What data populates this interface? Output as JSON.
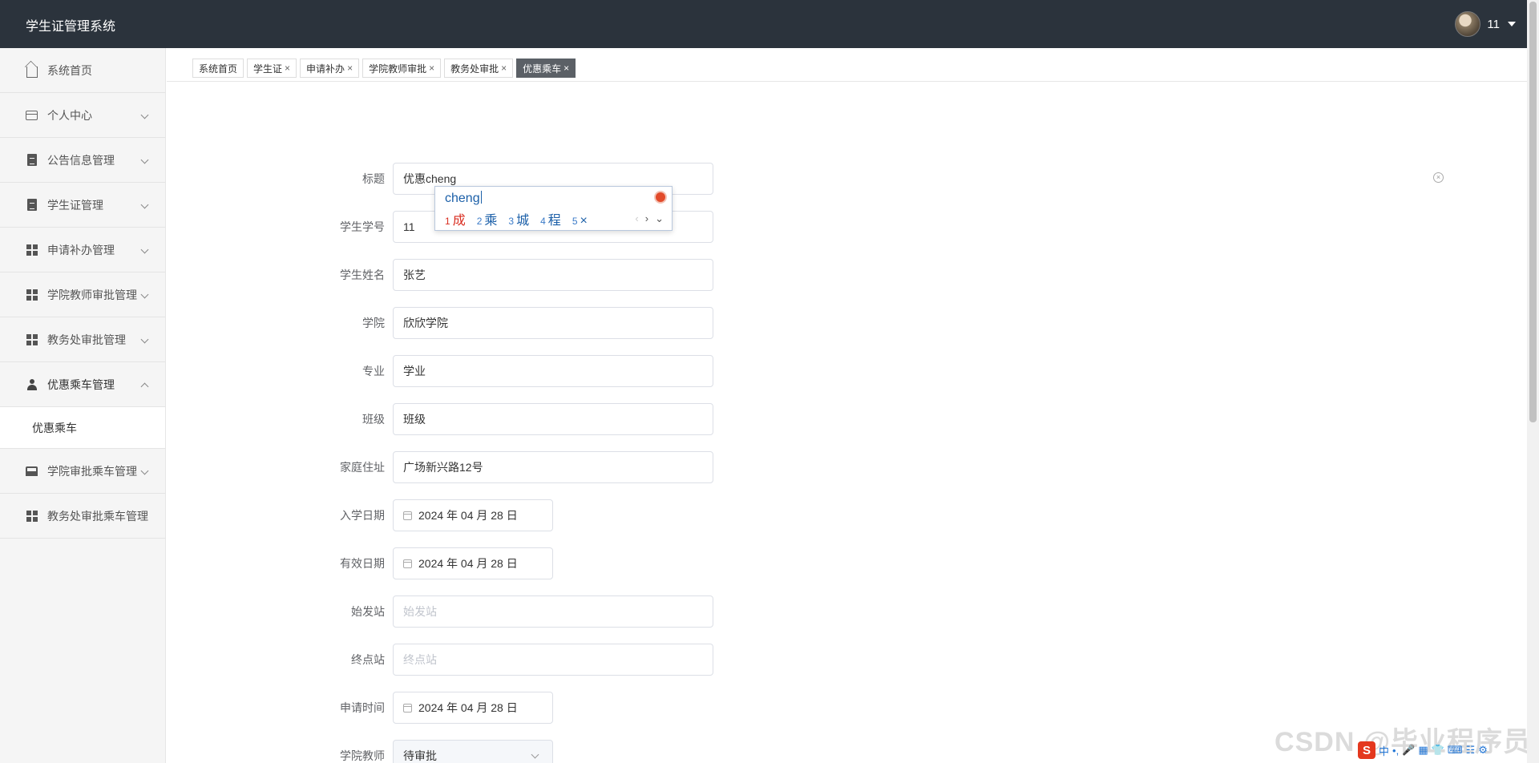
{
  "header": {
    "title": "学生证管理系统",
    "user_name": "11"
  },
  "sidebar": {
    "items": [
      {
        "label": "系统首页",
        "icon": "home-icon"
      },
      {
        "label": "个人中心",
        "icon": "card-icon"
      },
      {
        "label": "公告信息管理",
        "icon": "clipboard-icon"
      },
      {
        "label": "学生证管理",
        "icon": "clipboard-icon"
      },
      {
        "label": "申请补办管理",
        "icon": "grid-icon"
      },
      {
        "label": "学院教师审批管理",
        "icon": "grid-icon"
      },
      {
        "label": "教务处审批管理",
        "icon": "grid-icon"
      },
      {
        "label": "优惠乘车管理",
        "icon": "user-icon"
      },
      {
        "label": "优惠乘车"
      },
      {
        "label": "学院审批乘车管理",
        "icon": "bus-icon"
      },
      {
        "label": "教务处审批乘车管理",
        "icon": "grid-icon"
      }
    ]
  },
  "tabs": [
    {
      "label": "系统首页"
    },
    {
      "label": "学生证"
    },
    {
      "label": "申请补办"
    },
    {
      "label": "学院教师审批"
    },
    {
      "label": "教务处审批"
    },
    {
      "label": "优惠乘车"
    }
  ],
  "tab_close_glyph": "×",
  "form": {
    "title": {
      "label": "标题",
      "value": "优惠cheng"
    },
    "student_no": {
      "label": "学生学号",
      "value": "11"
    },
    "student_name": {
      "label": "学生姓名",
      "value": "张艺"
    },
    "college": {
      "label": "学院",
      "value": "欣欣学院"
    },
    "major": {
      "label": "专业",
      "value": "学业"
    },
    "class": {
      "label": "班级",
      "value": "班级"
    },
    "address": {
      "label": "家庭住址",
      "value": "广场新兴路12号"
    },
    "enroll_date": {
      "label": "入学日期",
      "value": "2024 年 04 月 28 日"
    },
    "valid_date": {
      "label": "有效日期",
      "value": "2024 年 04 月 28 日"
    },
    "start_station": {
      "label": "始发站",
      "placeholder": "始发站"
    },
    "end_station": {
      "label": "终点站",
      "placeholder": "终点站"
    },
    "apply_time": {
      "label": "申请时间",
      "value": "2024 年 04 月 28 日"
    },
    "college_teacher": {
      "label": "学院教师",
      "value": "待审批"
    }
  },
  "ime": {
    "pinyin": "cheng",
    "candidates": [
      {
        "n": "1",
        "text": "成"
      },
      {
        "n": "2",
        "text": "乘"
      },
      {
        "n": "3",
        "text": "城"
      },
      {
        "n": "4",
        "text": "程"
      },
      {
        "n": "5",
        "text": "×"
      }
    ],
    "nav_prev": "‹",
    "nav_next": "›",
    "nav_more": "⌄"
  },
  "watermark": "CSDN @毕业程序员",
  "tray": {
    "logo": "S",
    "items": [
      "中",
      "•,",
      "🎤",
      "▦",
      "👕",
      "⌨",
      "☷",
      "⚙"
    ]
  },
  "colors": {
    "topbar": "#2b333c",
    "sidebar": "#f5f5f5",
    "active_tab": "#5b6066",
    "ime_text": "#1b5fa8",
    "ime_first": "#d92d20"
  }
}
